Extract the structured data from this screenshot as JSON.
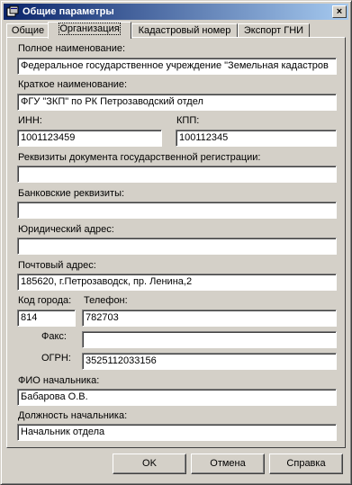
{
  "window": {
    "title": "Общие параметры",
    "close_label": "×",
    "icon": "app-icon"
  },
  "tabs": [
    "Общие",
    "Организация",
    "Кадастровый номер",
    "Экспорт ГНИ"
  ],
  "form": {
    "full_name": {
      "label": "Полное наименование:",
      "value": "Федеральное государственное учреждение \"Земельная кадастров"
    },
    "short_name": {
      "label": "Краткое наименование:",
      "value": "ФГУ \"ЗКП\" по РК Петрозаводский отдел"
    },
    "inn": {
      "label": "ИНН:",
      "value": "1001123459"
    },
    "kpp": {
      "label": "КПП:",
      "value": "100112345"
    },
    "reg_doc": {
      "label": "Реквизиты документа государственной регистрации:",
      "value": ""
    },
    "bank": {
      "label": "Банковские реквизиты:",
      "value": ""
    },
    "legal_address": {
      "label": "Юридический адрес:",
      "value": ""
    },
    "postal_address": {
      "label": "Почтовый адрес:",
      "value": "185620, г.Петрозаводск, пр. Ленина,2"
    },
    "city_code": {
      "label": "Код города:",
      "value": "814"
    },
    "phone": {
      "label": "Телефон:",
      "value": "782703"
    },
    "fax": {
      "label": "Факс:",
      "value": ""
    },
    "ogrn": {
      "label": "ОГРН:",
      "value": "3525112033156"
    },
    "chief_name": {
      "label": "ФИО начальника:",
      "value": "Бабарова О.В."
    },
    "chief_position": {
      "label": "Должность начальника:",
      "value": "Начальник отдела"
    }
  },
  "buttons": {
    "ok": "OK",
    "cancel": "Отмена",
    "help": "Справка"
  }
}
